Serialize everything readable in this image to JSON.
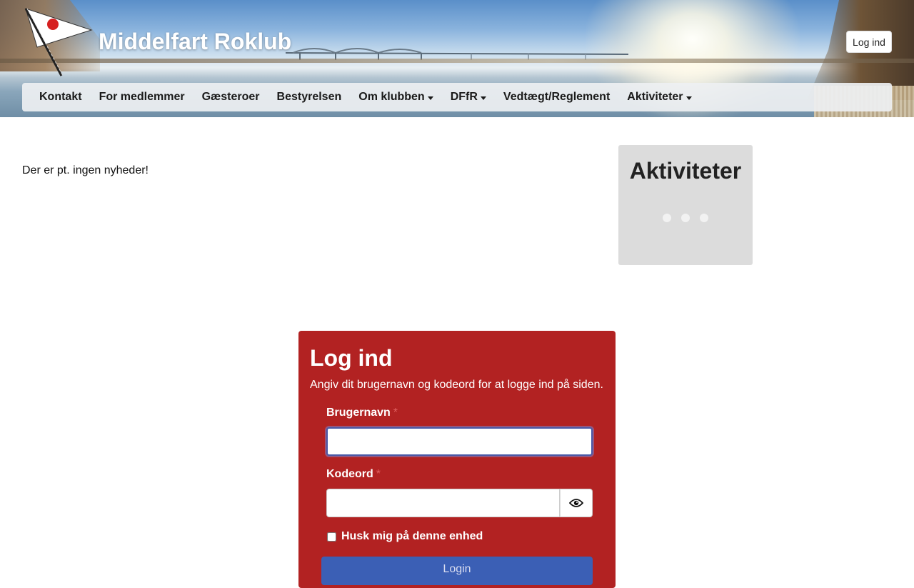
{
  "header": {
    "site_title": "Middelfart Roklub",
    "login_button": "Log ind"
  },
  "nav": {
    "items": [
      {
        "label": "Kontakt",
        "dropdown": false
      },
      {
        "label": "For medlemmer",
        "dropdown": false
      },
      {
        "label": "Gæsteroer",
        "dropdown": false
      },
      {
        "label": "Bestyrelsen",
        "dropdown": false
      },
      {
        "label": "Om klubben",
        "dropdown": true
      },
      {
        "label": "DFfR",
        "dropdown": true
      },
      {
        "label": "Vedtægt/Reglement",
        "dropdown": false
      },
      {
        "label": "Aktiviteter",
        "dropdown": true
      }
    ]
  },
  "main": {
    "news_empty": "Der er pt. ingen nyheder!"
  },
  "sidebar": {
    "activities_title": "Aktiviteter"
  },
  "login": {
    "title": "Log ind",
    "description": "Angiv dit brugernavn og kodeord for at logge ind på siden.",
    "username_label": "Brugernavn",
    "password_label": "Kodeord",
    "required_marker": "*",
    "username_value": "",
    "password_value": "",
    "remember_label": "Husk mig på denne enhed",
    "submit_label": "Login"
  },
  "colors": {
    "login_card": "#b22222",
    "submit_button": "#3b5fb5",
    "activities_box": "#dcdcdc"
  }
}
